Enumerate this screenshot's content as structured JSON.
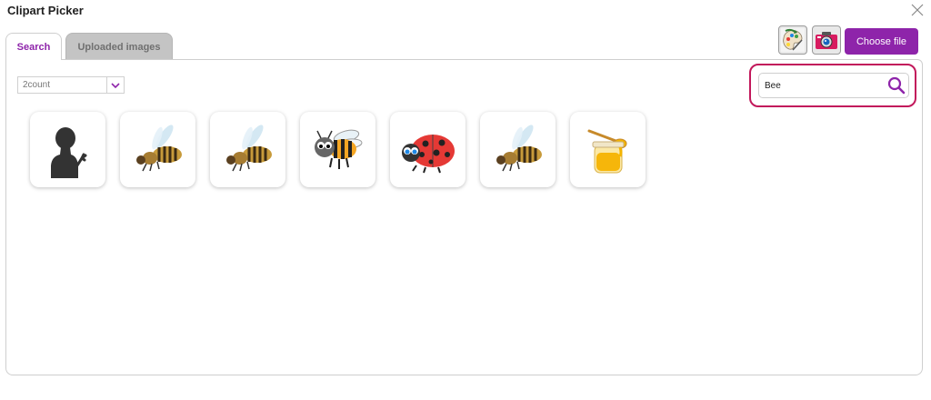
{
  "window": {
    "title": "Clipart Picker"
  },
  "tabs": [
    {
      "label": "Search",
      "active": true
    },
    {
      "label": "Uploaded images",
      "active": false
    }
  ],
  "toolbar": {
    "paint_icon": "paint-palette-icon",
    "camera_icon": "camera-icon",
    "choose_file_label": "Choose file"
  },
  "filter": {
    "selected": "2count"
  },
  "search": {
    "value": "Bee",
    "icon": "magnifier-icon"
  },
  "results": [
    {
      "name": "person-silhouette-waving",
      "icon": "person-silhouette-icon"
    },
    {
      "name": "honeybee",
      "icon": "honeybee-icon"
    },
    {
      "name": "honeybee",
      "icon": "honeybee-icon"
    },
    {
      "name": "cartoon-bumblebee",
      "icon": "cartoon-bee-icon"
    },
    {
      "name": "ladybug",
      "icon": "ladybug-icon"
    },
    {
      "name": "honeybee",
      "icon": "honeybee-icon"
    },
    {
      "name": "honey-jar",
      "icon": "honey-jar-icon"
    }
  ],
  "colors": {
    "accent": "#8e24aa",
    "highlight": "#c2185b",
    "tab_inactive": "#c4c4c4"
  }
}
